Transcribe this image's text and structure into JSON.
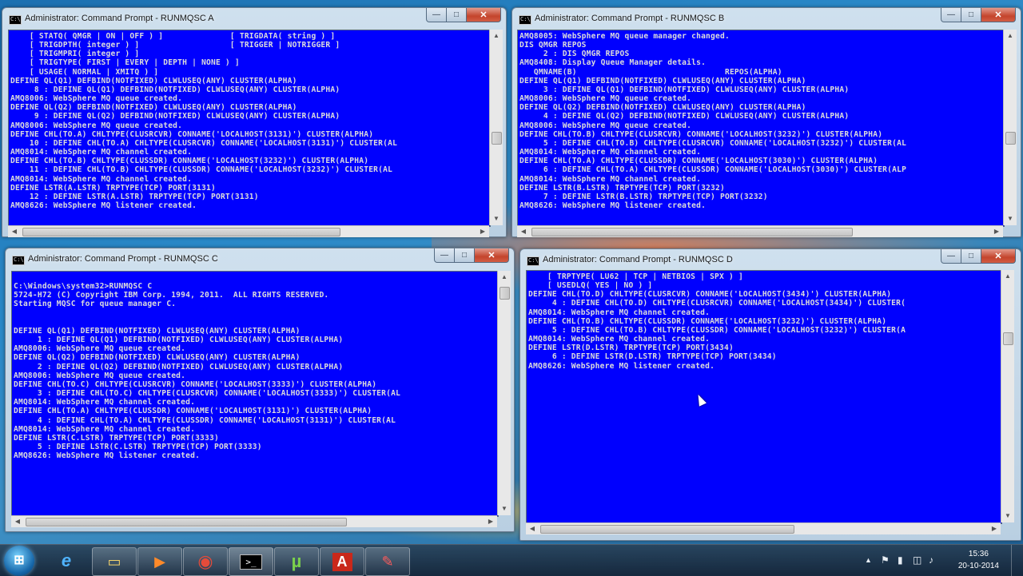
{
  "windows": [
    {
      "title": "Administrator: Command Prompt - RUNMQSC  A",
      "lines": [
        "    [ STATQ( QMGR | ON | OFF ) ]              [ TRIGDATA( string ) ]",
        "    [ TRIGDPTH( integer ) ]                   [ TRIGGER | NOTRIGGER ]",
        "    [ TRIGMPRI( integer ) ]",
        "    [ TRIGTYPE( FIRST | EVERY | DEPTH | NONE ) ]",
        "    [ USAGE( NORMAL | XMITQ ) ]",
        "DEFINE QL(Q1) DEFBIND(NOTFIXED) CLWLUSEQ(ANY) CLUSTER(ALPHA)",
        "     8 : DEFINE QL(Q1) DEFBIND(NOTFIXED) CLWLUSEQ(ANY) CLUSTER(ALPHA)",
        "AMQ8006: WebSphere MQ queue created.",
        "DEFINE QL(Q2) DEFBIND(NOTFIXED) CLWLUSEQ(ANY) CLUSTER(ALPHA)",
        "     9 : DEFINE QL(Q2) DEFBIND(NOTFIXED) CLWLUSEQ(ANY) CLUSTER(ALPHA)",
        "AMQ8006: WebSphere MQ queue created.",
        "DEFINE CHL(TO.A) CHLTYPE(CLUSRCVR) CONNAME('LOCALHOST(3131)') CLUSTER(ALPHA)",
        "    10 : DEFINE CHL(TO.A) CHLTYPE(CLUSRCVR) CONNAME('LOCALHOST(3131)') CLUSTER(AL",
        "AMQ8014: WebSphere MQ channel created.",
        "DEFINE CHL(TO.B) CHLTYPE(CLUSSDR) CONNAME('LOCALHOST(3232)') CLUSTER(ALPHA)",
        "    11 : DEFINE CHL(TO.B) CHLTYPE(CLUSSDR) CONNAME('LOCALHOST(3232)') CLUSTER(AL",
        "AMQ8014: WebSphere MQ channel created.",
        "DEFINE LSTR(A.LSTR) TRPTYPE(TCP) PORT(3131)",
        "    12 : DEFINE LSTR(A.LSTR) TRPTYPE(TCP) PORT(3131)",
        "AMQ8626: WebSphere MQ listener created."
      ]
    },
    {
      "title": "Administrator: Command Prompt - RUNMQSC  B",
      "lines": [
        "AMQ8005: WebSphere MQ queue manager changed.",
        "DIS QMGR REPOS",
        "     2 : DIS QMGR REPOS",
        "AMQ8408: Display Queue Manager details.",
        "   QMNAME(B)                               REPOS(ALPHA)",
        "DEFINE QL(Q1) DEFBIND(NOTFIXED) CLWLUSEQ(ANY) CLUSTER(ALPHA)",
        "     3 : DEFINE QL(Q1) DEFBIND(NOTFIXED) CLWLUSEQ(ANY) CLUSTER(ALPHA)",
        "AMQ8006: WebSphere MQ queue created.",
        "DEFINE QL(Q2) DEFBIND(NOTFIXED) CLWLUSEQ(ANY) CLUSTER(ALPHA)",
        "     4 : DEFINE QL(Q2) DEFBIND(NOTFIXED) CLWLUSEQ(ANY) CLUSTER(ALPHA)",
        "AMQ8006: WebSphere MQ queue created.",
        "DEFINE CHL(TO.B) CHLTYPE(CLUSRCVR) CONNAME('LOCALHOST(3232)') CLUSTER(ALPHA)",
        "     5 : DEFINE CHL(TO.B) CHLTYPE(CLUSRCVR) CONNAME('LOCALHOST(3232)') CLUSTER(AL",
        "AMQ8014: WebSphere MQ channel created.",
        "DEFINE CHL(TO.A) CHLTYPE(CLUSSDR) CONNAME('LOCALHOST(3030)') CLUSTER(ALPHA)",
        "     6 : DEFINE CHL(TO.A) CHLTYPE(CLUSSDR) CONNAME('LOCALHOST(3030)') CLUSTER(ALP",
        "AMQ8014: WebSphere MQ channel created.",
        "DEFINE LSTR(B.LSTR) TRPTYPE(TCP) PORT(3232)",
        "     7 : DEFINE LSTR(B.LSTR) TRPTYPE(TCP) PORT(3232)",
        "AMQ8626: WebSphere MQ listener created."
      ]
    },
    {
      "title": "Administrator: Command Prompt - RUNMQSC  C",
      "lines": [
        "",
        "C:\\Windows\\system32>RUNMQSC C",
        "5724-H72 (C) Copyright IBM Corp. 1994, 2011.  ALL RIGHTS RESERVED.",
        "Starting MQSC for queue manager C.",
        "",
        "",
        "DEFINE QL(Q1) DEFBIND(NOTFIXED) CLWLUSEQ(ANY) CLUSTER(ALPHA)",
        "     1 : DEFINE QL(Q1) DEFBIND(NOTFIXED) CLWLUSEQ(ANY) CLUSTER(ALPHA)",
        "AMQ8006: WebSphere MQ queue created.",
        "DEFINE QL(Q2) DEFBIND(NOTFIXED) CLWLUSEQ(ANY) CLUSTER(ALPHA)",
        "     2 : DEFINE QL(Q2) DEFBIND(NOTFIXED) CLWLUSEQ(ANY) CLUSTER(ALPHA)",
        "AMQ8006: WebSphere MQ queue created.",
        "DEFINE CHL(TO.C) CHLTYPE(CLUSRCVR) CONNAME('LOCALHOST(3333)') CLUSTER(ALPHA)",
        "     3 : DEFINE CHL(TO.C) CHLTYPE(CLUSRCVR) CONNAME('LOCALHOST(3333)') CLUSTER(AL",
        "AMQ8014: WebSphere MQ channel created.",
        "DEFINE CHL(TO.A) CHLTYPE(CLUSSDR) CONNAME('LOCALHOST(3131)') CLUSTER(ALPHA)",
        "     4 : DEFINE CHL(TO.A) CHLTYPE(CLUSSDR) CONNAME('LOCALHOST(3131)') CLUSTER(AL",
        "AMQ8014: WebSphere MQ channel created.",
        "DEFINE LSTR(C.LSTR) TRPTYPE(TCP) PORT(3333)",
        "     5 : DEFINE LSTR(C.LSTR) TRPTYPE(TCP) PORT(3333)",
        "AMQ8626: WebSphere MQ listener created."
      ]
    },
    {
      "title": "Administrator: Command Prompt - RUNMQSC  D",
      "lines": [
        "    [ TRPTYPE( LU62 | TCP | NETBIOS | SPX ) ]",
        "    [ USEDLQ( YES | NO ) ]",
        "DEFINE CHL(TO.D) CHLTYPE(CLUSRCVR) CONNAME('LOCALHOST(3434)') CLUSTER(ALPHA)",
        "     4 : DEFINE CHL(TO.D) CHLTYPE(CLUSRCVR) CONNAME('LOCALHOST(3434)') CLUSTER(",
        "AMQ8014: WebSphere MQ channel created.",
        "DEFINE CHL(TO.B) CHLTYPE(CLUSSDR) CONNAME('LOCALHOST(3232)') CLUSTER(ALPHA)",
        "     5 : DEFINE CHL(TO.B) CHLTYPE(CLUSSDR) CONNAME('LOCALHOST(3232)') CLUSTER(A",
        "AMQ8014: WebSphere MQ channel created.",
        "DEFINE LSTR(D.LSTR) TRPTYPE(TCP) PORT(3434)",
        "     6 : DEFINE LSTR(D.LSTR) TRPTYPE(TCP) PORT(3434)",
        "AMQ8626: WebSphere MQ listener created."
      ]
    }
  ],
  "window_controls": {
    "minimize": "—",
    "maximize": "□",
    "close": "✕",
    "cmd_icon": "C:\\"
  },
  "taskbar": {
    "start_glyph": "⊞",
    "icons": [
      {
        "name": "internet-explorer-icon",
        "glyph": "e"
      },
      {
        "name": "file-explorer-icon",
        "glyph": "▭"
      },
      {
        "name": "media-player-icon",
        "glyph": "▶"
      },
      {
        "name": "chrome-icon",
        "glyph": "◉"
      },
      {
        "name": "command-prompt-icon",
        "glyph": ">_"
      },
      {
        "name": "utorrent-icon",
        "glyph": "µ"
      },
      {
        "name": "acrobat-reader-icon",
        "glyph": "A"
      },
      {
        "name": "paint-icon",
        "glyph": "✎"
      }
    ],
    "tray_chevron": "▲",
    "time": "15:36",
    "date": "20-10-2014"
  },
  "colors": {
    "console_bg": "#0000fe",
    "console_fg": "#dcdcdc"
  }
}
